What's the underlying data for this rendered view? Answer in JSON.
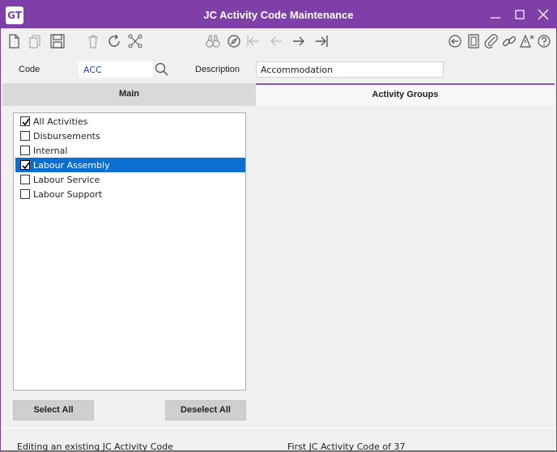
{
  "window": {
    "logo_text": "GT",
    "title": "JC Activity Code Maintenance",
    "accent_color": "#7e3fa9"
  },
  "toolbar": {
    "icons": [
      "new-icon",
      "copy-icon",
      "save-icon",
      "delete-icon",
      "refresh-icon",
      "network-icon",
      "binoculars-icon",
      "compass-icon",
      "first-icon",
      "previous-icon",
      "next-icon",
      "last-icon",
      "back-circle-icon",
      "notes-icon",
      "attachment-icon",
      "link-icon",
      "alert-icon",
      "help-icon"
    ]
  },
  "form": {
    "code_label": "Code",
    "code_value": "ACC",
    "description_label": "Description",
    "description_value": "Accommodation"
  },
  "tabs": [
    {
      "label": "Main",
      "active": false
    },
    {
      "label": "Activity Groups",
      "active": true
    }
  ],
  "activity_groups": [
    {
      "label": "All Activities",
      "checked": true,
      "selected": false
    },
    {
      "label": "Disbursements",
      "checked": false,
      "selected": false
    },
    {
      "label": "Internal",
      "checked": false,
      "selected": false
    },
    {
      "label": "Labour Assembly",
      "checked": true,
      "selected": true
    },
    {
      "label": "Labour Service",
      "checked": false,
      "selected": false
    },
    {
      "label": "Labour Support",
      "checked": false,
      "selected": false
    }
  ],
  "buttons": {
    "select_all": "Select All",
    "deselect_all": "Deselect All"
  },
  "status": {
    "left": "Editing an existing JC Activity Code",
    "right": "First JC Activity Code of 37"
  },
  "selection_color": "#0b6fd0"
}
